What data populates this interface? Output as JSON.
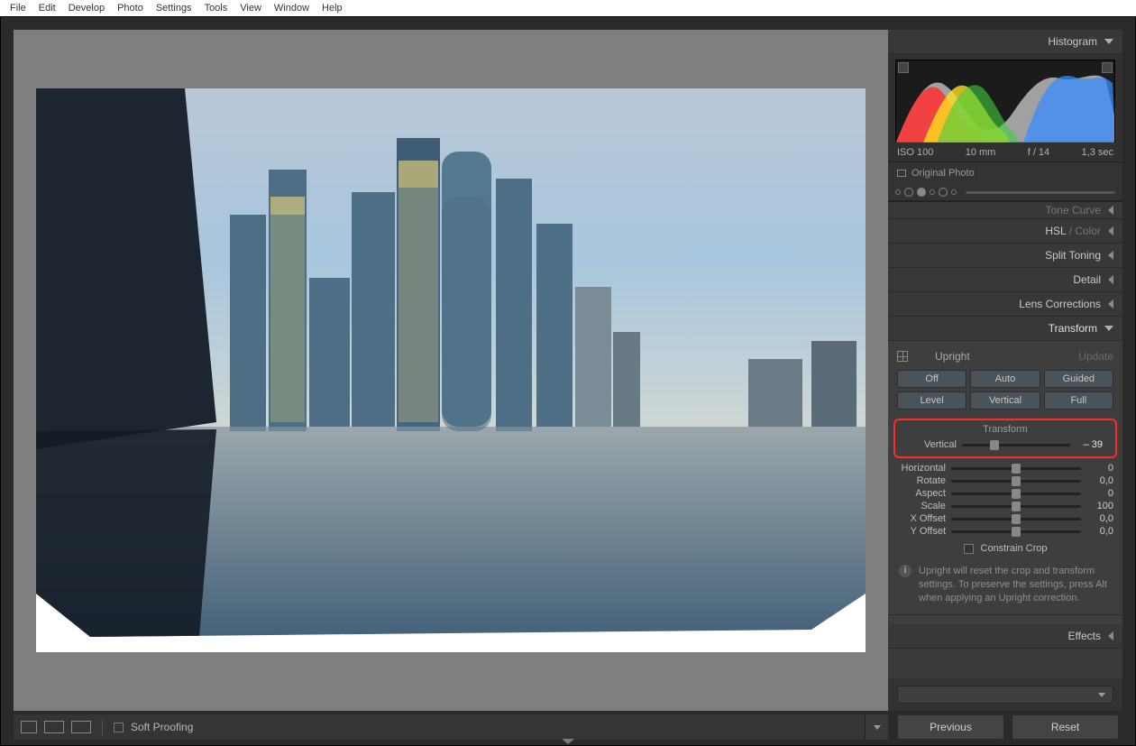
{
  "menu": [
    "File",
    "Edit",
    "Develop",
    "Photo",
    "Settings",
    "Tools",
    "View",
    "Window",
    "Help"
  ],
  "panels": {
    "histogram": "Histogram",
    "tone_curve": "Tone Curve",
    "hsl": "HSL",
    "color": "Color",
    "split_toning": "Split Toning",
    "detail": "Detail",
    "lens_corrections": "Lens Corrections",
    "transform": "Transform",
    "effects": "Effects"
  },
  "histogram_meta": {
    "iso": "ISO 100",
    "focal": "10 mm",
    "aperture": "f / 14",
    "shutter": "1,3 sec"
  },
  "original_photo": "Original Photo",
  "upright": {
    "label": "Upright",
    "update": "Update"
  },
  "upright_buttons": [
    "Off",
    "Auto",
    "Guided",
    "Level",
    "Vertical",
    "Full"
  ],
  "transform_title": "Transform",
  "sliders": {
    "vertical": {
      "label": "Vertical",
      "value": "– 39",
      "pos": 30
    },
    "horizontal": {
      "label": "Horizontal",
      "value": "0",
      "pos": 50
    },
    "rotate": {
      "label": "Rotate",
      "value": "0,0",
      "pos": 50
    },
    "aspect": {
      "label": "Aspect",
      "value": "0",
      "pos": 50
    },
    "scale": {
      "label": "Scale",
      "value": "100",
      "pos": 50
    },
    "xoffset": {
      "label": "X Offset",
      "value": "0,0",
      "pos": 50
    },
    "yoffset": {
      "label": "Y Offset",
      "value": "0,0",
      "pos": 50
    }
  },
  "constrain_crop": "Constrain Crop",
  "info_note": "Upright will reset the crop and transform settings. To preserve the settings, press Alt when applying an Upright correction.",
  "bottom": {
    "soft_proofing": "Soft Proofing",
    "previous": "Previous",
    "reset": "Reset"
  }
}
